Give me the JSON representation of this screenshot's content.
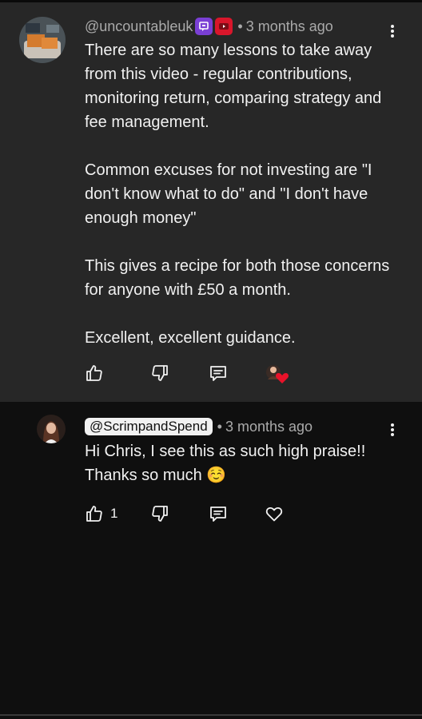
{
  "comments": [
    {
      "author": "@uncountableuk",
      "time": "3 months ago",
      "paragraphs": [
        "There are so many lessons to take away from this video - regular contributions, monitoring return, comparing strategy and fee management.",
        "Common excuses for not investing are \"I don't know what to do\" and \"I don't have enough money\"",
        "This gives a recipe for both those concerns for anyone with £50 a month.",
        "Excellent, excellent guidance."
      ],
      "likes": ""
    },
    {
      "author": "@ScrimpandSpend",
      "time": "3 months ago",
      "paragraphs": [
        "Hi Chris, I see this as such high praise!! Thanks so much ☺️"
      ],
      "likes": "1"
    }
  ],
  "separator": "•",
  "colors": {
    "highlight_bg": "#272727",
    "page_bg": "#0f0f0f",
    "heart_red": "#e8122a"
  }
}
